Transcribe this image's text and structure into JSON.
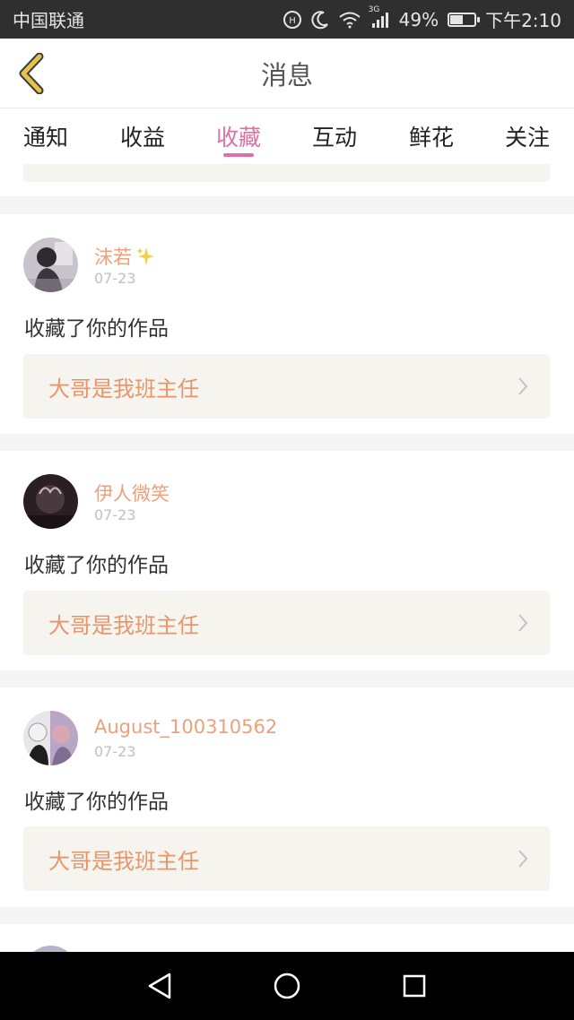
{
  "status_bar": {
    "carrier": "中国联通",
    "battery_percent": "49%",
    "time": "下午2:10",
    "network_label": "3G",
    "battery_level": 0.49,
    "icons": [
      "hd-icon",
      "moon-icon",
      "wifi-icon",
      "signal-icon",
      "battery-icon"
    ]
  },
  "header": {
    "title": "消息",
    "back_icon": "chevron-left-icon",
    "back_icon_color": "#d4a52b"
  },
  "tabs": [
    {
      "label": "通知",
      "active": false
    },
    {
      "label": "收益",
      "active": false
    },
    {
      "label": "收藏",
      "active": true
    },
    {
      "label": "互动",
      "active": false
    },
    {
      "label": "鲜花",
      "active": false
    },
    {
      "label": "关注",
      "active": false
    }
  ],
  "accent_color": "#e06fa6",
  "name_color": "#eea07a",
  "messages": [
    {
      "user": "沫若",
      "badge_icon": "sparkle-icon",
      "date": "07-23",
      "action": "收藏了你的作品",
      "work_title": "大哥是我班主任"
    },
    {
      "user": "伊人微笑",
      "date": "07-23",
      "action": "收藏了你的作品",
      "work_title": "大哥是我班主任"
    },
    {
      "user": "August_100310562",
      "date": "07-23",
      "action": "收藏了你的作品",
      "work_title": "大哥是我班主任"
    }
  ],
  "nav_bar": {
    "icons": [
      "back-triangle-icon",
      "home-circle-icon",
      "recents-square-icon"
    ]
  }
}
